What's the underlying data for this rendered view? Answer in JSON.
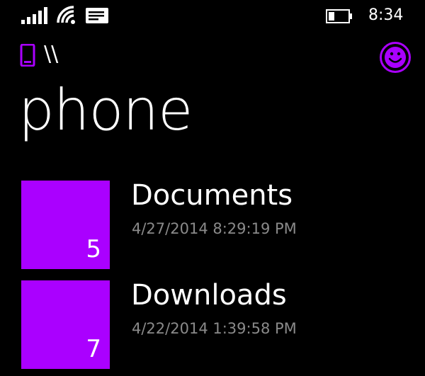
{
  "status_bar": {
    "time": "8:34",
    "icons": [
      "signal-icon",
      "wifi-icon",
      "notification-icon",
      "battery-icon"
    ]
  },
  "header": {
    "location_icon": "phone-icon",
    "path": "\\\\",
    "title": "phone",
    "action_icon": "smiley-icon"
  },
  "folders": [
    {
      "name": "Documents",
      "date": "4/27/2014 8:29:19 PM",
      "count": "5"
    },
    {
      "name": "Downloads",
      "date": "4/22/2014 1:39:58 PM",
      "count": "7"
    }
  ],
  "colors": {
    "accent": "#aa00ff",
    "background": "#000000",
    "text": "#ffffff",
    "secondary_text": "#8a8a8a"
  }
}
